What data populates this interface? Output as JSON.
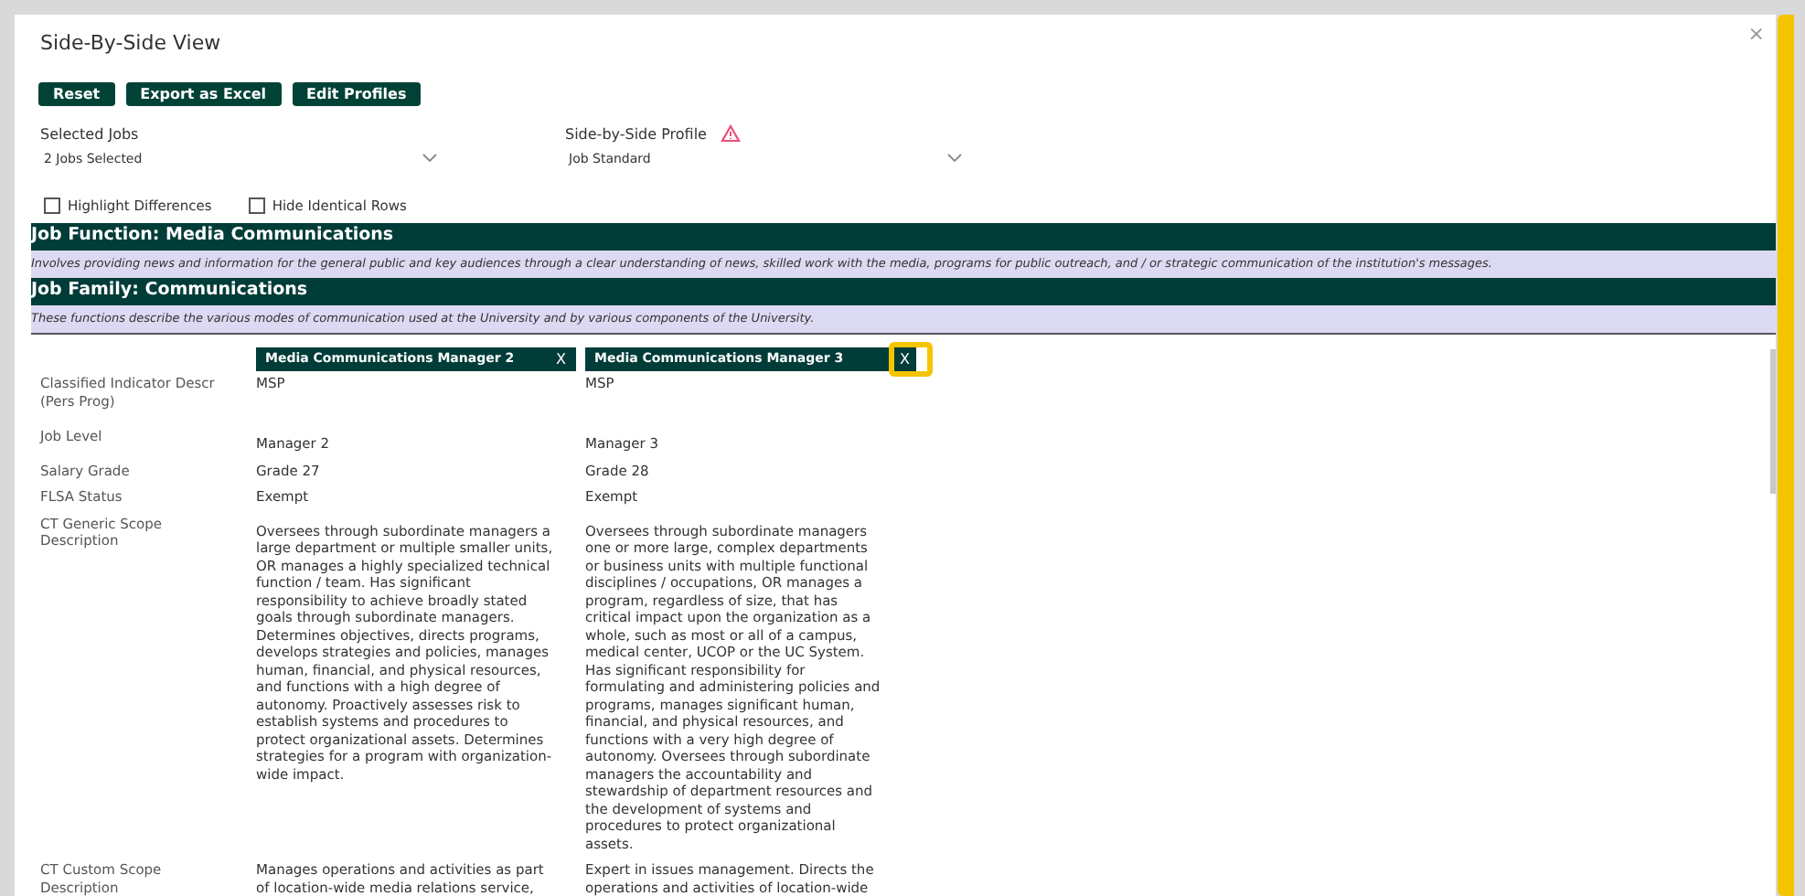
{
  "dialog": {
    "title": "Side-By-Side View",
    "close": "×"
  },
  "buttons": [
    "Reset",
    "Export as Excel",
    "Edit Profiles"
  ],
  "selects": [
    {
      "label": "Selected Jobs",
      "value": "2 Jobs Selected",
      "warning": false
    },
    {
      "label": "Side-by-Side Profile",
      "value": "Job Standard",
      "warning": true
    }
  ],
  "options": [
    {
      "label": "Highlight Differences",
      "checked": false
    },
    {
      "label": "Hide Identical Rows",
      "checked": false
    }
  ],
  "sections": [
    {
      "title": "Job Function: Media Communications",
      "description": "Involves providing news and information for the general public and key audiences through a clear understanding of news, skilled work with the media, programs for public outreach, and / or strategic communication of the institution's messages."
    },
    {
      "title": "Job Family: Communications",
      "description": "These functions describe the various modes of communication used at the University and by various components of the University."
    }
  ],
  "jobs": [
    {
      "title": "Media Communications Manager 2",
      "remove": "X",
      "highlighted": false
    },
    {
      "title": "Media Communications Manager 3",
      "remove": "X",
      "highlighted": true
    }
  ],
  "rows": [
    {
      "label": "Classified Indicator Descr\n(Pers Prog)",
      "values": [
        "MSP",
        "MSP"
      ]
    },
    {
      "label": "Job Level",
      "values": [
        "Manager 2",
        "Manager 3"
      ]
    },
    {
      "label": "Salary Grade",
      "values": [
        "Grade 27",
        "Grade 28"
      ]
    },
    {
      "label": "FLSA Status",
      "values": [
        "Exempt",
        "Exempt"
      ]
    },
    {
      "label": "CT Generic Scope\nDescription",
      "values": [
        "Oversees through subordinate managers a\nlarge department or multiple smaller units,\nOR manages a highly specialized technical\nfunction / team. Has significant\nresponsibility to achieve broadly stated\ngoals through subordinate managers.\nDetermines objectives, directs programs,\ndevelops strategies and policies, manages\nhuman, financial, and physical resources,\nand functions with a high degree of\nautonomy. Proactively assesses risk to\nestablish systems and procedures to\nprotect organizational assets. Determines\nstrategies for a program with organization-\nwide impact.",
        "Oversees through subordinate managers\none or more large, complex departments\nor business units with multiple functional\ndisciplines / occupations, OR manages a\nprogram, regardless of size, that has\ncritical impact upon the organization as a\nwhole, such as most or all of a campus,\nmedical center, UCOP or the UC System.\nHas significant responsibility for\nformulating and administering policies and\nprograms, manages significant human,\nfinancial, and physical resources, and\nfunctions with a very high degree of\nautonomy. Oversees through subordinate\nmanagers the accountability and\nstewardship of department resources and\nthe development of systems and\nprocedures to protect organizational\nassets."
      ]
    },
    {
      "label": "CT Custom Scope\nDescription",
      "values": [
        "Manages operations and activities as part\nof location-wide media relations service,",
        "Expert in issues management. Directs the\noperations and activities of location-wide"
      ]
    }
  ]
}
